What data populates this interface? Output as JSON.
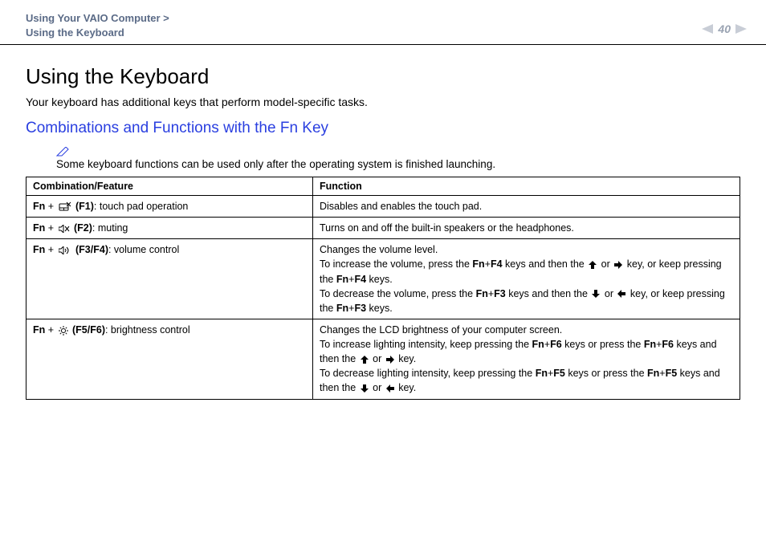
{
  "header": {
    "breadcrumb_line1": "Using Your VAIO Computer >",
    "breadcrumb_line2": "Using the Keyboard",
    "page_number": "40"
  },
  "title": "Using the Keyboard",
  "intro": "Your keyboard has additional keys that perform model-specific tasks.",
  "subtitle": "Combinations and Functions with the Fn Key",
  "note": "Some keyboard functions can be used only after the operating system is finished launching.",
  "table": {
    "head": {
      "c1": "Combination/Feature",
      "c2": "Function"
    },
    "rows": [
      {
        "combo_prefix": "Fn",
        "combo_plus": " + ",
        "combo_key": " (F1)",
        "combo_desc": ": touch pad operation",
        "func": "Disables and enables the touch pad."
      },
      {
        "combo_prefix": "Fn",
        "combo_plus": " + ",
        "combo_key": " (F2)",
        "combo_desc": ": muting",
        "func": "Turns on and off the built-in speakers or the headphones."
      },
      {
        "combo_prefix": "Fn",
        "combo_plus": " + ",
        "combo_key": " (F3/F4)",
        "combo_desc": ": volume control",
        "func_l1": "Changes the volume level.",
        "func_l2a": "To increase the volume, press the ",
        "func_l2b": "Fn",
        "func_l2c": "+",
        "func_l2d": "F4",
        "func_l2e": " keys and then the ",
        "func_l2f": " or ",
        "func_l2g": " key, or keep pressing the ",
        "func_l2h": "Fn",
        "func_l2i": "+",
        "func_l2j": "F4",
        "func_l2k": " keys.",
        "func_l3a": "To decrease the volume, press the ",
        "func_l3b": "Fn",
        "func_l3c": "+",
        "func_l3d": "F3",
        "func_l3e": " keys and then the ",
        "func_l3f": " or ",
        "func_l3g": " key, or keep pressing the ",
        "func_l3h": "Fn",
        "func_l3i": "+",
        "func_l3j": "F3",
        "func_l3k": " keys."
      },
      {
        "combo_prefix": "Fn",
        "combo_plus": " + ",
        "combo_key": " (F5/F6)",
        "combo_desc": ": brightness control",
        "func_l1": "Changes the LCD brightness of your computer screen.",
        "func_l2a": "To increase lighting intensity, keep pressing the ",
        "func_l2b": "Fn",
        "func_l2c": "+",
        "func_l2d": "F6",
        "func_l2e": " keys or press the ",
        "func_l2f": "Fn",
        "func_l2g": "+",
        "func_l2h": "F6",
        "func_l2i": " keys and then the ",
        "func_l2j": " or ",
        "func_l2k": " key.",
        "func_l3a": "To decrease lighting intensity, keep pressing the ",
        "func_l3b": "Fn",
        "func_l3c": "+",
        "func_l3d": "F5",
        "func_l3e": " keys or press the ",
        "func_l3f": "Fn",
        "func_l3g": "+",
        "func_l3h": "F5",
        "func_l3i": " keys and then the ",
        "func_l3j": " or ",
        "func_l3k": " key."
      }
    ]
  }
}
